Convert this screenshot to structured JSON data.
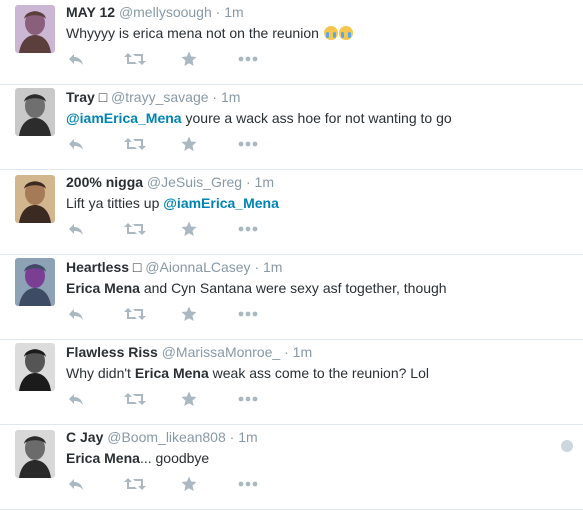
{
  "tweets": [
    {
      "name": "MAY 12",
      "handle": "@mellysoough",
      "time": "1m",
      "segments": [
        {
          "t": "Whyyyy is erica mena not on the reunion ",
          "s": ""
        }
      ],
      "emoji": [
        "loudly-crying-face",
        "loudly-crying-face"
      ],
      "avatar_colors": [
        "#cbb6d4",
        "#5b3f3c",
        "#8a5f7b"
      ]
    },
    {
      "name": "Tray □",
      "handle": "@trayy_savage",
      "time": "1m",
      "segments": [
        {
          "t": "@iamErica_Mena",
          "s": "mention"
        },
        {
          "t": " youre a wack ass hoe for not wanting to go",
          "s": ""
        }
      ],
      "avatar_colors": [
        "#c9c9c9",
        "#2c2c2c",
        "#6f6f6f"
      ]
    },
    {
      "name": "200% nigga",
      "handle": "@JeSuis_Greg",
      "time": "1m",
      "segments": [
        {
          "t": "Lift ya titties up ",
          "s": ""
        },
        {
          "t": "@iamErica_Mena",
          "s": "mention"
        }
      ],
      "avatar_colors": [
        "#d2b78e",
        "#3a2a22",
        "#a57a56"
      ]
    },
    {
      "name": "Heartless □",
      "handle": "@AionnaLCasey",
      "time": "1m",
      "segments": [
        {
          "t": "Erica Mena",
          "s": "bold"
        },
        {
          "t": " and Cyn Santana were sexy asf together,  though",
          "s": ""
        }
      ],
      "avatar_colors": [
        "#8ea2b6",
        "#3d4b64",
        "#7a3f93"
      ]
    },
    {
      "name": "Flawless Riss",
      "handle": "@MarissaMonroe_",
      "time": "1m",
      "segments": [
        {
          "t": "Why didn't ",
          "s": ""
        },
        {
          "t": "Erica Mena",
          "s": "bold"
        },
        {
          "t": " weak ass come to the reunion? Lol",
          "s": ""
        }
      ],
      "avatar_colors": [
        "#dcdcdc",
        "#1b1b1b",
        "#555555"
      ]
    },
    {
      "name": "C Jay",
      "handle": "@Boom_likean808",
      "time": "1m",
      "segments": [
        {
          "t": "Erica Mena",
          "s": "bold"
        },
        {
          "t": "... goodbye",
          "s": ""
        }
      ],
      "avatar_colors": [
        "#d8d8d8",
        "#2a2a2a",
        "#6b6b6b"
      ],
      "has_dismiss": true
    }
  ],
  "actions": [
    "reply-icon",
    "retweet-icon",
    "favorite-icon",
    "more-icon"
  ],
  "colors": {
    "name": "#292f33",
    "meta": "#8899a6",
    "mention": "#0084b4",
    "action": "#aab8c2",
    "divider": "#e1e8ed"
  }
}
